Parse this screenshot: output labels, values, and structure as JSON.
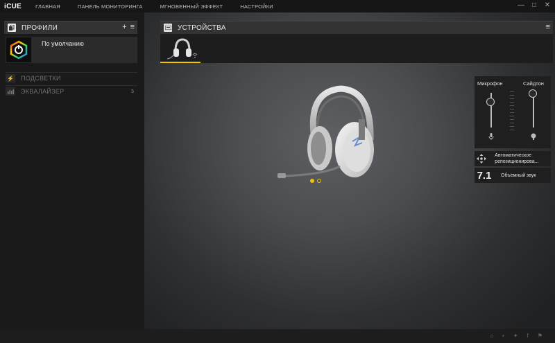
{
  "app": {
    "logo": "iCUE",
    "nav": [
      "ГЛАВНАЯ",
      "ПАНЕЛЬ МОНИТОРИНГА",
      "МГНОВЕННЫЙ ЭФФЕКТ",
      "НАСТРОЙКИ"
    ],
    "window_controls": {
      "minimize": "—",
      "maximize": "□",
      "close": "✕"
    }
  },
  "profiles": {
    "title": "ПРОФИЛИ",
    "add": "+",
    "menu": "≡",
    "items": [
      {
        "name": "По умолчанию"
      }
    ]
  },
  "left_menu": [
    {
      "label": "ПОДСВЕТКИ",
      "icon": "lightning-icon",
      "count": ""
    },
    {
      "label": "ЭКВАЛАЙЗЕР",
      "icon": "equalizer-icon",
      "count": "5"
    }
  ],
  "devices": {
    "title": "УСТРОЙСТВА",
    "menu": "≡",
    "selected": "wireless-headset"
  },
  "carousel": {
    "active_index": 0,
    "total": 2
  },
  "audio": {
    "mic_label": "Микрофон",
    "sidetone_label": "Сайдтон",
    "mic_level": 0.7,
    "sidetone_level": 1.0,
    "auto_reposition": "Автоматическое репозиционирова...",
    "surround_badge": "7.1",
    "surround_label": "Объемный звук"
  },
  "colors": {
    "accent": "#f0c400"
  }
}
